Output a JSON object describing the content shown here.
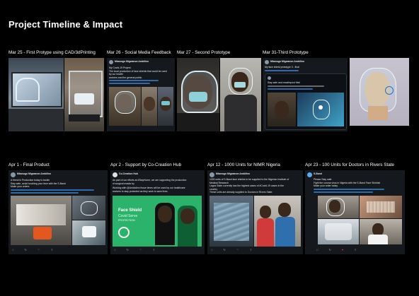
{
  "page": {
    "title": "Project Timeline & Impact"
  },
  "milestones": {
    "m1": "Mar 25 - First Protype using CAD/3dPrinting",
    "m2": "Mar 26 - Social Media Feedback",
    "m3": "Mar 27 - Second Prototype",
    "m4": "Mar 31-Third Prototype",
    "m5": "Apr 1 - Final Product",
    "m6": "Apr 2 - Support by Co-Creation Hub",
    "m7": "Apr 12 - 1000 Units for NIMR Nigeria",
    "m8": "Apr 23 - 100 Units for Doctors in Rivers State"
  },
  "tweets": {
    "t2": {
      "author": "Mbanugo Migwanon Ambilinn",
      "line1": "My Covid-19 Project.",
      "line2": "The local production of face shields that could be used",
      "line3": "by our health",
      "line4": "workers and the general public."
    },
    "t4": {
      "author": "Mbanugo Migwanon Ambilinn",
      "line1": "My face shield prototype 3 - final",
      "line2": "Stay safe and read/repost this!"
    },
    "t5": {
      "author": "Mbanugo Migwanon Ambilinn",
      "line1": "A friend in Production today to tackle",
      "line2": "Stay safe, avoid touching your face with the S-Band",
      "line3": "Make your orders"
    },
    "t6": {
      "author": "Co-Creation Hub",
      "line1": "As part of our efforts at #StayHome, we are supporting the production",
      "line2": "of surgical masks by",
      "line3": "Working with @Ambiolinn those times will be used by our healthcare",
      "line4": "workers to stay protected as they work to save lives.",
      "badge_top": "Face Shield",
      "badge_sub": "Covid Serve",
      "badge_tag": "PROTECTION"
    },
    "t7": {
      "author": "Mbanugo Migwanon Ambilinn",
      "line1": "1000 units of S-Band face shields to be supplied to the Nigerian Institute of",
      "line2": "Medical Research",
      "line3": "Lagos State currently has the highest cases of #Covid-19 cases in the",
      "line4": "country.",
      "line5": "These units are already supplied to Doctors in Rivers State."
    },
    "t8": {
      "author": "S-Band",
      "line1": "Please Stay safe.",
      "line2": "Fight the corona virus in Nigeria with the S-Band Face Shields!",
      "line3": "Make your order today."
    }
  },
  "colors": {
    "background": "#000000",
    "tweet_bg": "#15181c",
    "link": "#3a8ee6",
    "brand_green": "#2bb36b"
  }
}
